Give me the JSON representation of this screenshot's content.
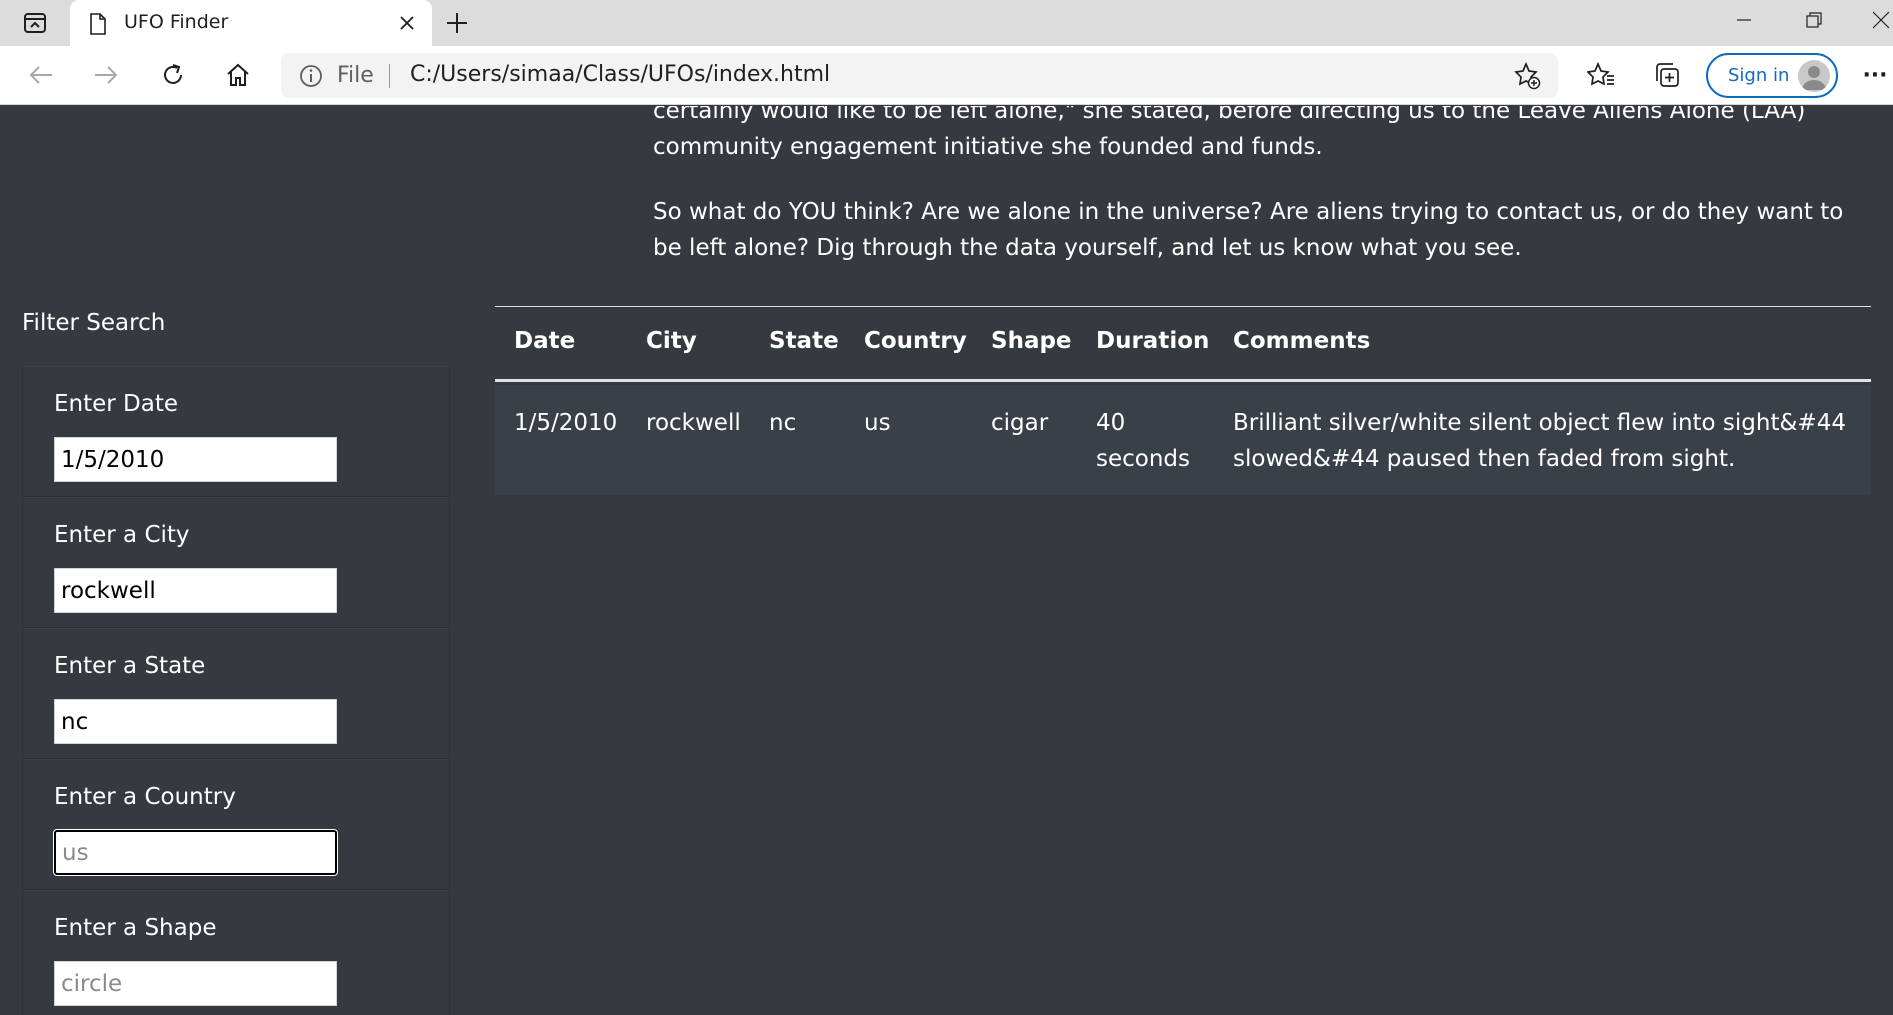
{
  "browser": {
    "tab_title": "UFO Finder",
    "address_prefix": "File",
    "url": "C:/Users/simaa/Class/UFOs/index.html",
    "signin_label": "Sign in",
    "more_label": "···"
  },
  "intro": {
    "paragraph_1": "certainly would like to be left alone,\" she stated, before directing us to the Leave Aliens Alone (LAA) community engagement initiative she founded and funds.",
    "paragraph_2": "So what do YOU think? Are we alone in the universe? Are aliens trying to contact us, or do they want to be left alone? Dig through the data yourself, and let us know what you see."
  },
  "filters": {
    "title": "Filter Search",
    "items": [
      {
        "label": "Enter Date",
        "value": "1/5/2010",
        "placeholder": ""
      },
      {
        "label": "Enter a City",
        "value": "rockwell",
        "placeholder": ""
      },
      {
        "label": "Enter a State",
        "value": "nc",
        "placeholder": ""
      },
      {
        "label": "Enter a Country",
        "value": "",
        "placeholder": "us"
      },
      {
        "label": "Enter a Shape",
        "value": "",
        "placeholder": "circle"
      }
    ]
  },
  "table": {
    "headers": [
      "Date",
      "City",
      "State",
      "Country",
      "Shape",
      "Duration",
      "Comments"
    ],
    "rows": [
      [
        "1/5/2010",
        "rockwell",
        "nc",
        "us",
        "cigar",
        "40 seconds",
        "Brilliant silver/white silent object flew into sight&#44 slowed&#44 paused then faded from sight."
      ]
    ]
  },
  "colors": {
    "page_bg": "#343a40",
    "accent": "#0f6cbd"
  }
}
